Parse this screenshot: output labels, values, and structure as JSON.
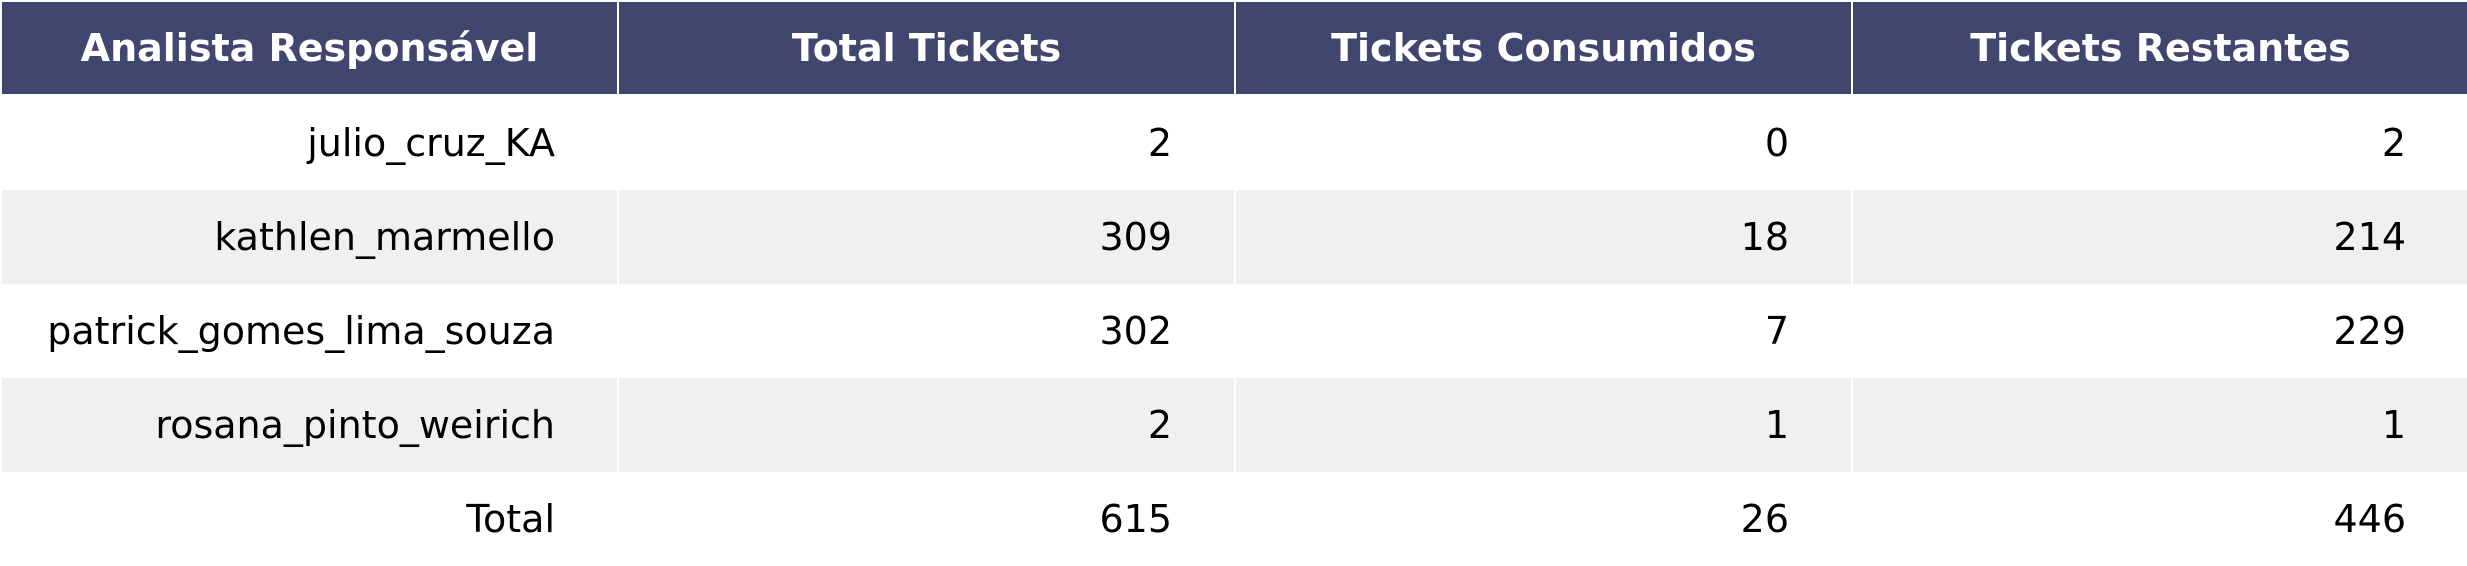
{
  "chart_data": {
    "type": "table",
    "columns": [
      "Analista Responsável",
      "Total Tickets",
      "Tickets Consumidos",
      "Tickets Restantes"
    ],
    "rows": [
      [
        "julio_cruz_KA",
        "2",
        "0",
        "2"
      ],
      [
        "kathlen_marmello",
        "309",
        "18",
        "214"
      ],
      [
        "patrick_gomes_lima_souza",
        "302",
        "7",
        "229"
      ],
      [
        "rosana_pinto_weirich",
        "2",
        "1",
        "1"
      ],
      [
        "Total",
        "615",
        "26",
        "446"
      ]
    ],
    "colors": {
      "header_background": "#40466e",
      "header_text": "#ffffff",
      "row_alt_background": "#f0f0f0",
      "row_background": "#ffffff"
    }
  }
}
